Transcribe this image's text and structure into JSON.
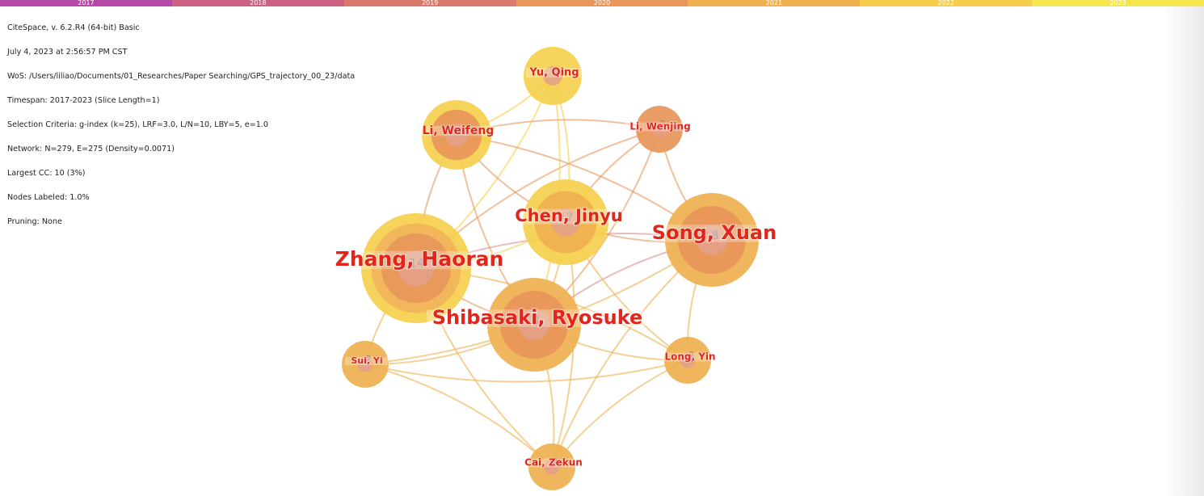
{
  "timeline": {
    "years": [
      "2017",
      "2018",
      "2019",
      "2020",
      "2021",
      "2022",
      "2023"
    ],
    "colors": [
      "#b44aa6",
      "#cc6183",
      "#d97a6a",
      "#e8965a",
      "#efb04f",
      "#f5cf4c",
      "#f4e64c"
    ]
  },
  "info": {
    "lines": [
      "CiteSpace, v. 6.2.R4 (64-bit) Basic",
      "July 4, 2023 at 2:56:57 PM CST",
      "WoS: /Users/liliao/Documents/01_Researches/Paper Searching/GPS_trajectory_00_23/data",
      "Timespan: 2017-2023 (Slice Length=1)",
      "Selection Criteria: g-index (k=25), LRF=3.0, L/N=10, LBY=5, e=1.0",
      "Network: N=279, E=275 (Density=0.0071)",
      "Largest CC: 10 (3%)",
      "Nodes Labeled: 1.0%",
      "Pruning: None"
    ]
  },
  "network": {
    "nodes": [
      {
        "id": "zhang",
        "label": "Zhang, Haoran",
        "count": "14",
        "value": 14,
        "ring_colors": [
          "#f5cf4c",
          "#f0b45a",
          "#e8965a"
        ]
      },
      {
        "id": "shibasaki",
        "label": "Shibasaki, Ryosuke",
        "count": "8",
        "value": 8,
        "ring_colors": [
          "#efb04f",
          "#e8965a"
        ]
      },
      {
        "id": "song",
        "label": "Song, Xuan",
        "count": "8",
        "value": 8,
        "ring_colors": [
          "#efb04f",
          "#e8965a"
        ]
      },
      {
        "id": "chen",
        "label": "Chen, Jinyu",
        "count": "7",
        "value": 7,
        "ring_colors": [
          "#f5cf4c",
          "#efb04f"
        ]
      },
      {
        "id": "li_weifeng",
        "label": "Li, Weifeng",
        "count": "4",
        "value": 4,
        "ring_colors": [
          "#f5cf4c",
          "#e8965a"
        ]
      },
      {
        "id": "yu",
        "label": "Yu, Qing",
        "count": "3",
        "value": 3,
        "ring_colors": [
          "#f5cf4c"
        ]
      },
      {
        "id": "li_wenjing",
        "label": "Li, Wenjing",
        "count": "2",
        "value": 2,
        "ring_colors": [
          "#e8965a"
        ]
      },
      {
        "id": "sui",
        "label": "Sui, Yi",
        "count": "2",
        "value": 2,
        "ring_colors": [
          "#efb04f"
        ]
      },
      {
        "id": "long",
        "label": "Long, Yin",
        "count": "2",
        "value": 2,
        "ring_colors": [
          "#efb04f"
        ]
      },
      {
        "id": "cai",
        "label": "Cai, Zekun",
        "count": "2",
        "value": 2,
        "ring_colors": [
          "#efb04f"
        ]
      }
    ],
    "links": [
      {
        "source": "zhang",
        "target": "shibasaki",
        "color": "#e8965a"
      },
      {
        "source": "zhang",
        "target": "song",
        "color": "#d99090"
      },
      {
        "source": "zhang",
        "target": "chen",
        "color": "#f5cf4c"
      },
      {
        "source": "zhang",
        "target": "li_weifeng",
        "color": "#e8965a"
      },
      {
        "source": "zhang",
        "target": "yu",
        "color": "#f5cf4c"
      },
      {
        "source": "zhang",
        "target": "li_wenjing",
        "color": "#e8965a"
      },
      {
        "source": "zhang",
        "target": "sui",
        "color": "#efb04f"
      },
      {
        "source": "zhang",
        "target": "long",
        "color": "#efb04f"
      },
      {
        "source": "zhang",
        "target": "cai",
        "color": "#efb04f"
      },
      {
        "source": "shibasaki",
        "target": "song",
        "color": "#d99090"
      },
      {
        "source": "shibasaki",
        "target": "chen",
        "color": "#efb04f"
      },
      {
        "source": "shibasaki",
        "target": "li_weifeng",
        "color": "#e8965a"
      },
      {
        "source": "shibasaki",
        "target": "li_wenjing",
        "color": "#e8965a"
      },
      {
        "source": "shibasaki",
        "target": "sui",
        "color": "#efb04f"
      },
      {
        "source": "shibasaki",
        "target": "long",
        "color": "#efb04f"
      },
      {
        "source": "shibasaki",
        "target": "cai",
        "color": "#efb04f"
      },
      {
        "source": "shibasaki",
        "target": "yu",
        "color": "#f5cf4c"
      },
      {
        "source": "song",
        "target": "chen",
        "color": "#e8965a"
      },
      {
        "source": "song",
        "target": "li_weifeng",
        "color": "#e8965a"
      },
      {
        "source": "song",
        "target": "li_wenjing",
        "color": "#e8965a"
      },
      {
        "source": "song",
        "target": "long",
        "color": "#efb04f"
      },
      {
        "source": "song",
        "target": "sui",
        "color": "#efb04f"
      },
      {
        "source": "song",
        "target": "cai",
        "color": "#efb04f"
      },
      {
        "source": "chen",
        "target": "li_weifeng",
        "color": "#e8965a"
      },
      {
        "source": "chen",
        "target": "yu",
        "color": "#f5cf4c"
      },
      {
        "source": "chen",
        "target": "li_wenjing",
        "color": "#e8965a"
      },
      {
        "source": "chen",
        "target": "long",
        "color": "#efb04f"
      },
      {
        "source": "chen",
        "target": "cai",
        "color": "#efb04f"
      },
      {
        "source": "li_weifeng",
        "target": "yu",
        "color": "#f5cf4c"
      },
      {
        "source": "li_weifeng",
        "target": "li_wenjing",
        "color": "#e8965a"
      },
      {
        "source": "sui",
        "target": "long",
        "color": "#efb04f"
      },
      {
        "source": "sui",
        "target": "cai",
        "color": "#efb04f"
      },
      {
        "source": "long",
        "target": "cai",
        "color": "#efb04f"
      }
    ]
  }
}
